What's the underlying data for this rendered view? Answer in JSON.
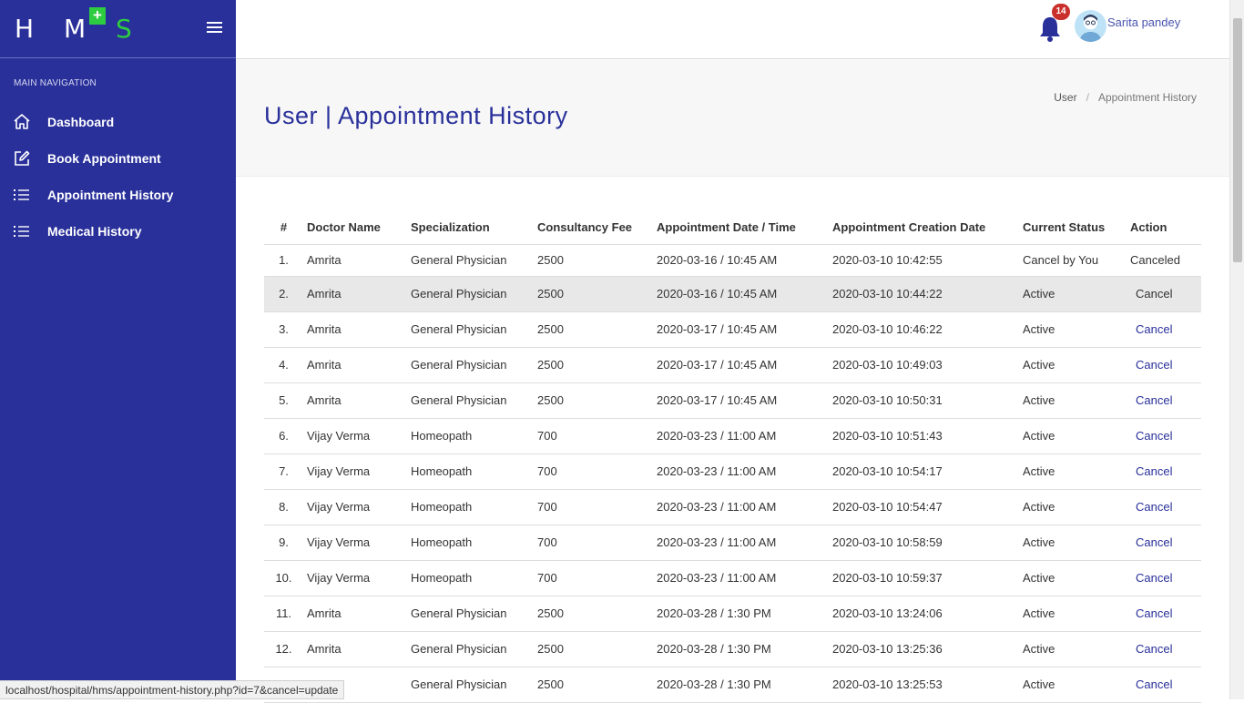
{
  "brand": {
    "logo_text_a": "H M",
    "logo_text_b": "S",
    "logo_plus": "+"
  },
  "sidebar": {
    "header": "MAIN NAVIGATION",
    "items": [
      {
        "label": "Dashboard",
        "icon": "home-icon"
      },
      {
        "label": "Book Appointment",
        "icon": "edit-icon"
      },
      {
        "label": "Appointment History",
        "icon": "list-icon"
      },
      {
        "label": "Medical History",
        "icon": "list-icon"
      }
    ]
  },
  "topbar": {
    "notification_count": "14",
    "username": "Sarita pandey"
  },
  "page": {
    "title": "User | Appointment History",
    "breadcrumb": [
      "User",
      "/",
      "Appointment History"
    ]
  },
  "table": {
    "headers": [
      "#",
      "Doctor Name",
      "Specialization",
      "Consultancy Fee",
      "Appointment Date / Time",
      "Appointment Creation Date",
      "Current Status",
      "Action"
    ],
    "rows": [
      [
        "1.",
        "Amrita",
        "General Physician",
        "2500",
        "2020-03-16 / 10:45 AM",
        "2020-03-10 10:42:55",
        "Cancel by You",
        "Canceled"
      ],
      [
        "2.",
        "Amrita",
        "General Physician",
        "2500",
        "2020-03-16 / 10:45 AM",
        "2020-03-10 10:44:22",
        "Active",
        "Cancel"
      ],
      [
        "3.",
        "Amrita",
        "General Physician",
        "2500",
        "2020-03-17 / 10:45 AM",
        "2020-03-10 10:46:22",
        "Active",
        "Cancel"
      ],
      [
        "4.",
        "Amrita",
        "General Physician",
        "2500",
        "2020-03-17 / 10:45 AM",
        "2020-03-10 10:49:03",
        "Active",
        "Cancel"
      ],
      [
        "5.",
        "Amrita",
        "General Physician",
        "2500",
        "2020-03-17 / 10:45 AM",
        "2020-03-10 10:50:31",
        "Active",
        "Cancel"
      ],
      [
        "6.",
        "Vijay Verma",
        "Homeopath",
        "700",
        "2020-03-23 / 11:00 AM",
        "2020-03-10 10:51:43",
        "Active",
        "Cancel"
      ],
      [
        "7.",
        "Vijay Verma",
        "Homeopath",
        "700",
        "2020-03-23 / 11:00 AM",
        "2020-03-10 10:54:17",
        "Active",
        "Cancel"
      ],
      [
        "8.",
        "Vijay Verma",
        "Homeopath",
        "700",
        "2020-03-23 / 11:00 AM",
        "2020-03-10 10:54:47",
        "Active",
        "Cancel"
      ],
      [
        "9.",
        "Vijay Verma",
        "Homeopath",
        "700",
        "2020-03-23 / 11:00 AM",
        "2020-03-10 10:58:59",
        "Active",
        "Cancel"
      ],
      [
        "10.",
        "Vijay Verma",
        "Homeopath",
        "700",
        "2020-03-23 / 11:00 AM",
        "2020-03-10 10:59:37",
        "Active",
        "Cancel"
      ],
      [
        "11.",
        "Amrita",
        "General Physician",
        "2500",
        "2020-03-28 / 1:30 PM",
        "2020-03-10 13:24:06",
        "Active",
        "Cancel"
      ],
      [
        "12.",
        "Amrita",
        "General Physician",
        "2500",
        "2020-03-28 / 1:30 PM",
        "2020-03-10 13:25:36",
        "Active",
        "Cancel"
      ],
      [
        "",
        "",
        "General Physician",
        "2500",
        "2020-03-28 / 1:30 PM",
        "2020-03-10 13:25:53",
        "Active",
        "Cancel"
      ]
    ]
  },
  "status_bar": {
    "url": "localhost/hospital/hms/appointment-history.php?id=7&cancel=update"
  },
  "colors": {
    "sidebar": "#29309a",
    "accent": "#2ecc40",
    "title": "#29309a",
    "badge": "#c9302c"
  }
}
